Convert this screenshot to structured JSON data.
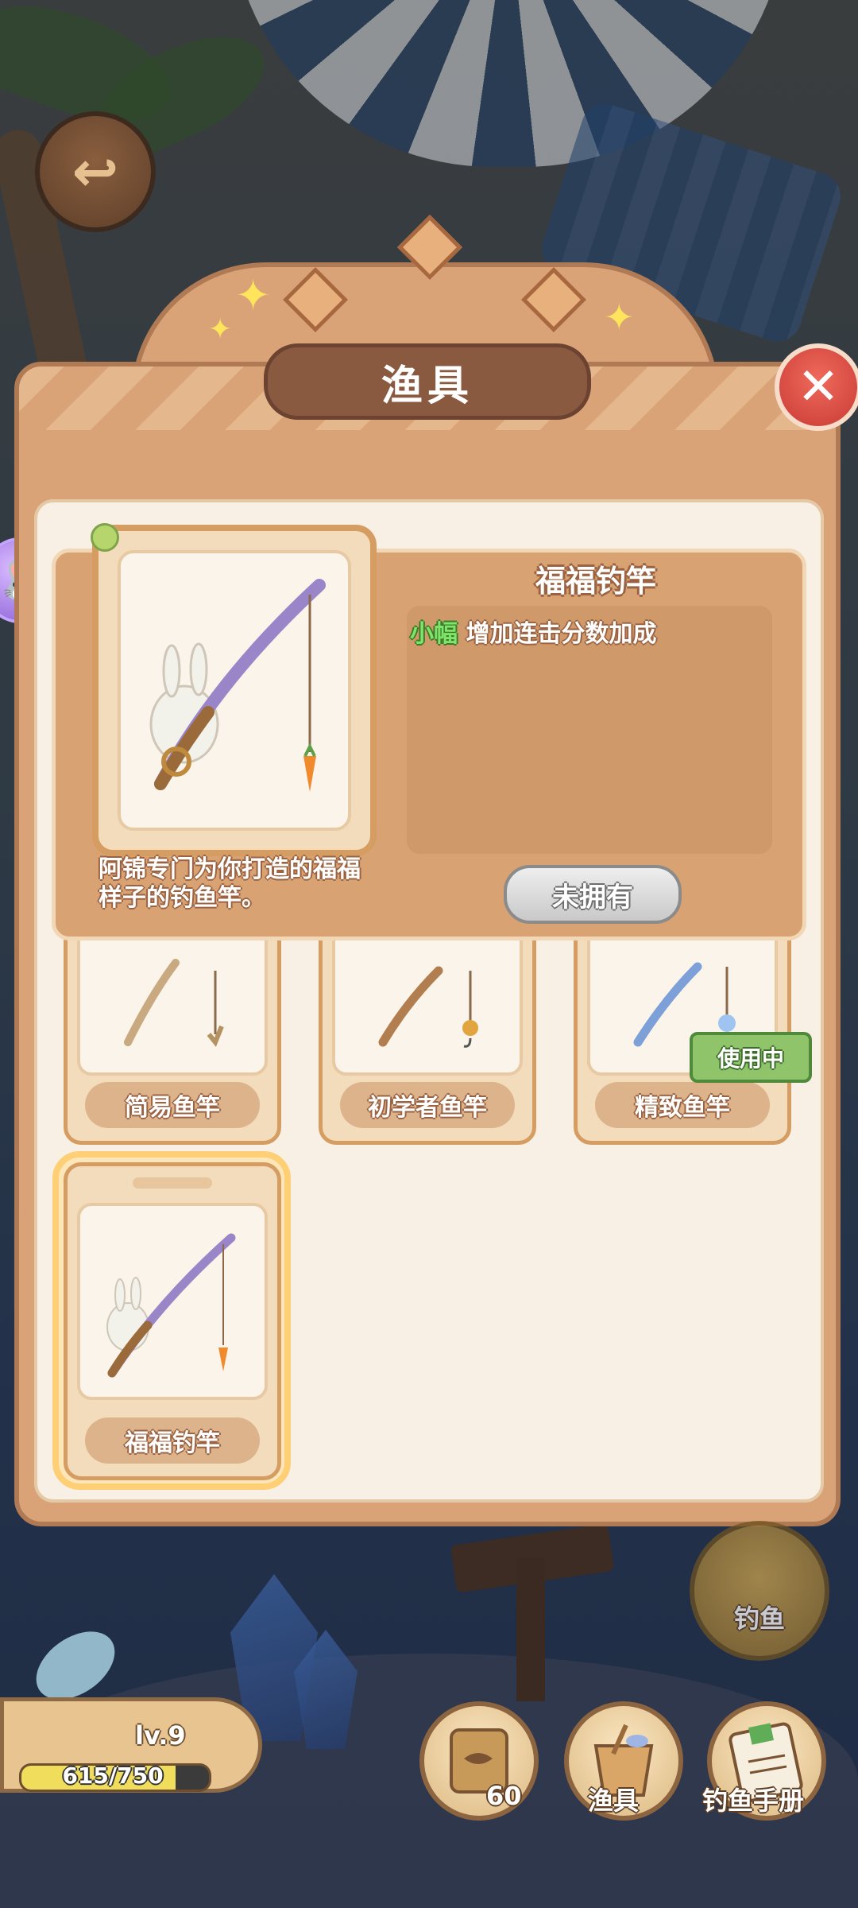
{
  "dialog": {
    "title": "渔具",
    "selected": {
      "name": "福福钓竿",
      "effect_tag": "小幅",
      "effect_text": "增加连击分数加成",
      "description": "阿锦专门为你打造的福福样子的钓鱼竿。",
      "status": "未拥有"
    },
    "rods": [
      {
        "label": "简易鱼竿"
      },
      {
        "label": "初学者鱼竿"
      },
      {
        "label": "精致鱼竿",
        "badge": "使用中"
      },
      {
        "label": "福福钓竿"
      }
    ]
  },
  "hud": {
    "level": "lv.9",
    "xp_text": "615/750",
    "xp_fraction": 0.82,
    "fish_label": "钓鱼",
    "bag_count": "60",
    "gear_label": "渔具",
    "handbook_label": "钓鱼手册"
  }
}
